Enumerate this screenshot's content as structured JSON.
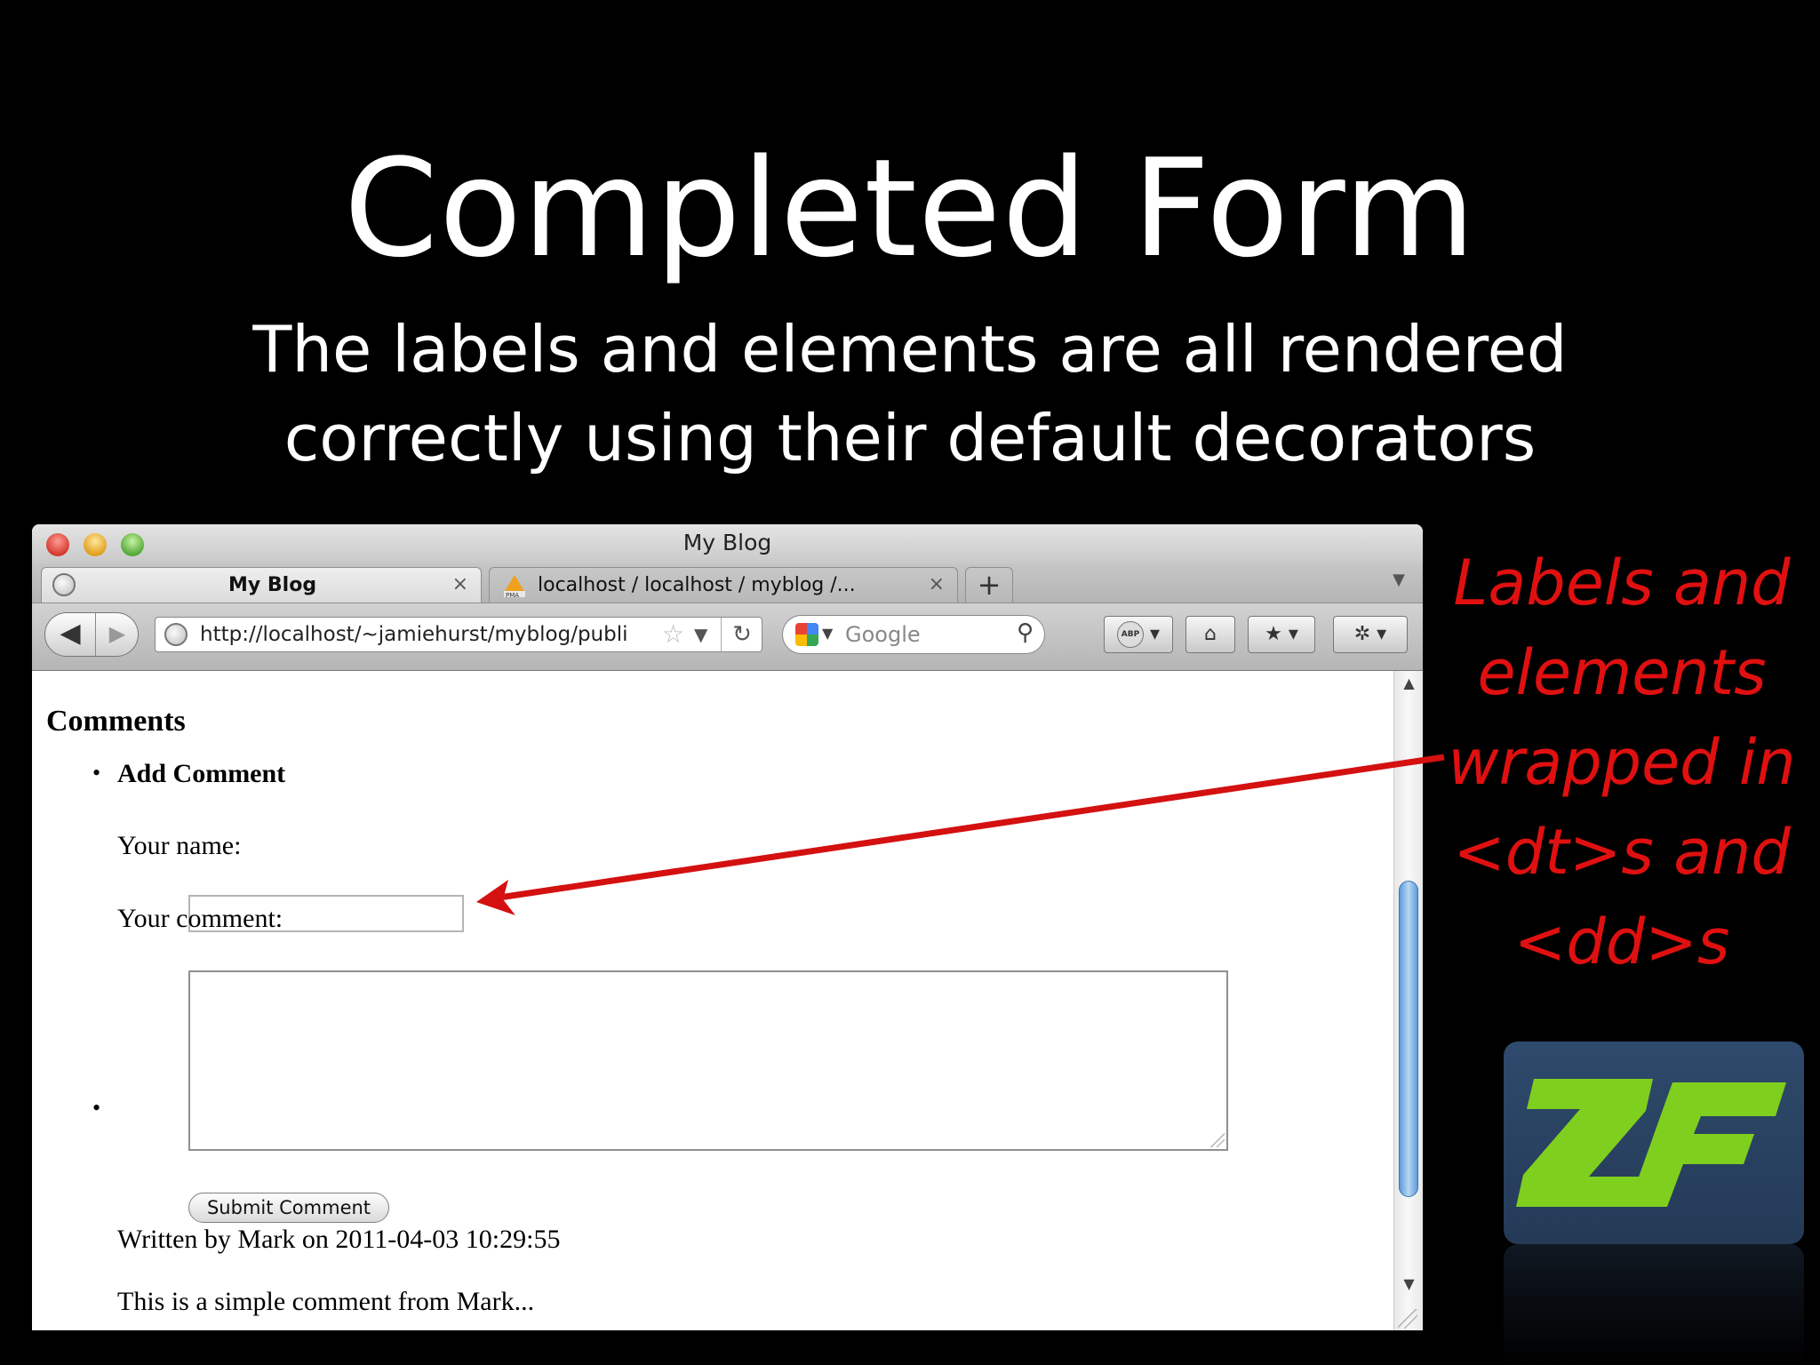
{
  "slide": {
    "title": "Completed Form",
    "subtitle_line1": "The labels and elements are all rendered",
    "subtitle_line2": "correctly using their default decorators"
  },
  "browser": {
    "window_title": "My Blog",
    "tabs": [
      {
        "label": "My Blog",
        "active": true
      },
      {
        "label": "localhost / localhost / myblog /...",
        "active": false
      }
    ],
    "new_tab_label": "+",
    "url": "http://localhost/~jamiehurst/myblog/publi",
    "search_placeholder": "Google",
    "toolbar_icons": [
      "back-icon",
      "forward-icon",
      "reload-icon",
      "adblock-icon",
      "home-icon",
      "bookmark-icon",
      "extension-icon"
    ]
  },
  "page": {
    "heading": "Comments",
    "add_comment": "Add Comment",
    "name_label": "Your name:",
    "comment_label": "Your comment:",
    "name_value": "",
    "comment_value": "",
    "submit_label": "Submit Comment",
    "written_by": "Written by Mark on 2011-04-03 10:29:55",
    "comment_body": "This is a simple comment from Mark..."
  },
  "annotation": {
    "lines": [
      "Labels and",
      "elements",
      "wrapped in",
      "<dt>s and",
      "<dd>s"
    ],
    "color": "#e01010"
  },
  "logo": {
    "text": "ZF",
    "color": "#7fcf1e"
  }
}
